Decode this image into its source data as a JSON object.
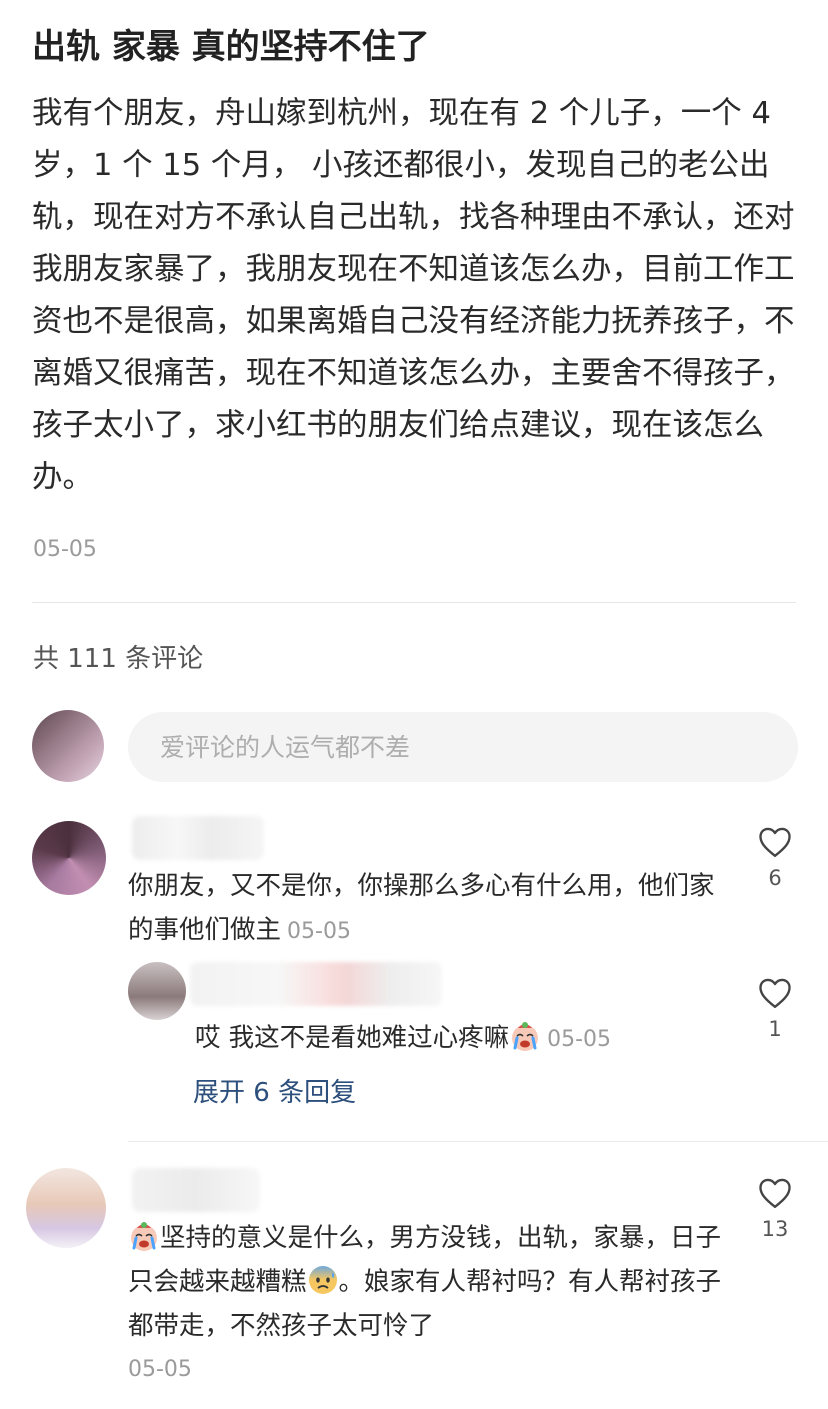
{
  "post": {
    "title": "出轨 家暴 真的坚持不住了",
    "body": "我有个朋友，舟山嫁到杭州，现在有 2 个儿子，一个 4 岁，1 个 15 个月， 小孩还都很小，发现自己的老公出轨，现在对方不承认自己出轨，找各种理由不承认，还对我朋友家暴了，我朋友现在不知道该怎么办，目前工作工资也不是很高，如果离婚自己没有经济能力抚养孩子，不离婚又很痛苦，现在不知道该怎么办，主要舍不得孩子，孩子太小了，求小红书的朋友们给点建议，现在该怎么办。",
    "date": "05-05"
  },
  "comments_header": {
    "count_text": "共 111 条评论"
  },
  "comment_input": {
    "placeholder": "爱评论的人运气都不差"
  },
  "comments": [
    {
      "text": "你朋友，又不是你，你操那么多心有什么用，他们家的事他们做主",
      "date": "05-05",
      "likes": "6"
    },
    {
      "text": "哎 我这不是看她难过心疼嘛",
      "emoji": "crying-face-emoji",
      "date": "05-05",
      "likes": "1",
      "expand_label": "展开 6 条回复"
    },
    {
      "text_part1": "坚持的意义是什么，男方没钱，出轨，家暴，日子只会越来越糟糕",
      "text_part2": "。娘家有人帮衬吗？有人帮衬孩子都带走，不然孩子太可怜了",
      "emoji_lead": "crying-face-emoji",
      "emoji_mid": "anxious-sweat-face-emoji",
      "date": "05-05",
      "likes": "13"
    }
  ],
  "colors": {
    "link": "#2c4f7c",
    "meta": "#9a9a9a",
    "text": "#2a2a2a"
  }
}
